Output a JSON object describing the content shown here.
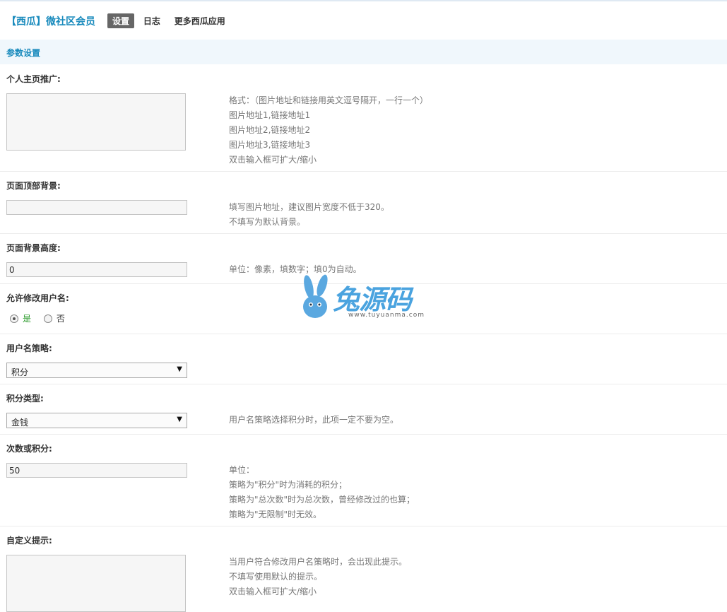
{
  "header": {
    "app_title": "【西瓜】微社区会员",
    "nav": [
      {
        "label": "设置",
        "active": true
      },
      {
        "label": "日志",
        "active": false
      },
      {
        "label": "更多西瓜应用",
        "active": false
      }
    ]
  },
  "section": {
    "title": "参数设置"
  },
  "settings": {
    "homepage_promo": {
      "label": "个人主页推广:",
      "value": "",
      "hint": [
        "格式：（图片地址和链接用英文逗号隔开，一行一个）",
        "图片地址1,链接地址1",
        "图片地址2,链接地址2",
        "图片地址3,链接地址3",
        "双击输入框可扩大/缩小"
      ]
    },
    "page_top_bg": {
      "label": "页面顶部背景:",
      "value": "",
      "hint": [
        "填写图片地址，建议图片宽度不低于320。",
        "不填写为默认背景。"
      ]
    },
    "bg_height": {
      "label": "页面背景高度:",
      "value": "0",
      "hint": [
        "单位：像素，填数字；填0为自动。"
      ]
    },
    "allow_rename": {
      "label": "允许修改用户名:",
      "options": [
        {
          "label": "是",
          "checked": true
        },
        {
          "label": "否",
          "checked": false
        }
      ]
    },
    "name_strategy": {
      "label": "用户名策略:",
      "selected": "积分"
    },
    "credit_type": {
      "label": "积分类型:",
      "selected": "金钱",
      "hint": [
        "用户名策略选择积分时，此项一定不要为空。"
      ]
    },
    "times_or_credits": {
      "label": "次数或积分:",
      "value": "50",
      "hint": [
        "单位：",
        "策略为\"积分\"时为消耗的积分；",
        "策略为\"总次数\"时为总次数，曾经修改过的也算；",
        "策略为\"无限制\"时无效。"
      ]
    },
    "custom_tip": {
      "label": "自定义提示:",
      "value": "",
      "hint": [
        "当用户符合修改用户名策略时，会出现此提示。",
        "不填写使用默认的提示。",
        "双击输入框可扩大/缩小"
      ]
    }
  },
  "watermark": {
    "text": "兔源码",
    "sub": "www.tuyuanma.com"
  }
}
